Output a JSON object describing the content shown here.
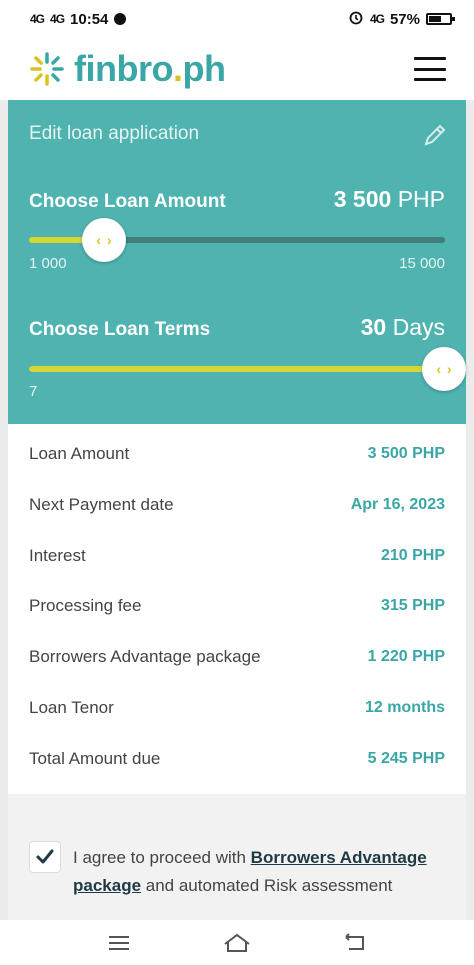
{
  "status_bar": {
    "signal": "4G",
    "signal2": "4G",
    "time": "10:54",
    "battery": "57%",
    "network": "4G"
  },
  "header": {
    "logo_main": "finbro",
    "logo_dot": ".",
    "logo_suffix": "ph",
    "menu_icon": "hamburger-menu-icon"
  },
  "panel": {
    "edit_label": "Edit loan application",
    "edit_icon": "pencil-icon",
    "amount": {
      "title": "Choose Loan Amount",
      "value": "3 500",
      "unit": "PHP",
      "min_label": "1 000",
      "max_label": "15 000",
      "fraction": 0.18
    },
    "terms": {
      "title": "Choose Loan Terms",
      "value": "30",
      "unit": "Days",
      "min_label": "7",
      "fraction": 1.0
    },
    "knob_left": "‹",
    "knob_right": "›"
  },
  "summary": {
    "rows": [
      {
        "label": "Loan Amount",
        "value": "3 500 PHP"
      },
      {
        "label": "Next Payment date",
        "value": "Apr 16, 2023"
      },
      {
        "label": "Interest",
        "value": "210 PHP"
      },
      {
        "label": "Processing fee",
        "value": "315 PHP"
      },
      {
        "label": "Borrowers Advantage package",
        "value": "1 220 PHP"
      },
      {
        "label": "Loan Tenor",
        "value": "12 months"
      },
      {
        "label": "Total Amount due",
        "value": "5 245 PHP"
      }
    ]
  },
  "agreement": {
    "checked": true,
    "text_before": "I agree to proceed with ",
    "link_text": "Borrowers Advantage package",
    "text_after": " and automated Risk assessment"
  },
  "colors": {
    "teal": "#4fb3b0",
    "accent_text": "#3aa6a5",
    "yellow": "#d7d635"
  }
}
